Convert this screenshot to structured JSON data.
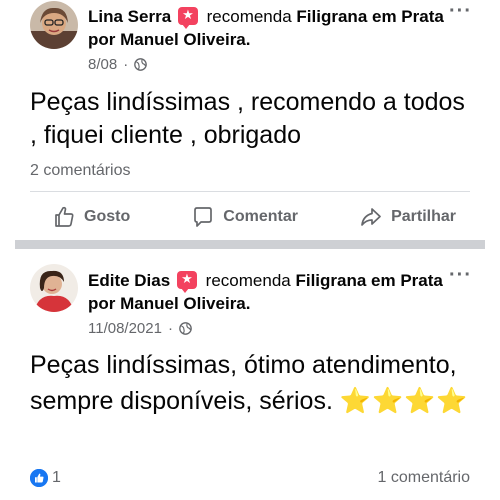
{
  "posts": [
    {
      "author": "Lina Serra",
      "verb": "recomenda",
      "page": "Filigrana em Prata por Manuel Oliveira.",
      "date": "8/08",
      "separator": "·",
      "text": "Peças lindíssimas , recomendo a todos , fiquei cliente , obrigado",
      "comments": "2 comentários",
      "actions": {
        "like": "Gosto",
        "comment": "Comentar",
        "share": "Partilhar"
      }
    },
    {
      "author": "Edite Dias",
      "verb": "recomenda",
      "page": "Filigrana em Prata por Manuel Oliveira.",
      "date": "11/08/2021",
      "separator": "·",
      "text": "Peças lindíssimas, ótimo atendimento, sempre disponíveis, sérios.",
      "stars": "⭐⭐⭐⭐",
      "reactions_count": "1",
      "comments": "1 comentário"
    }
  ],
  "icons": {
    "recommend": "recommend-star-icon",
    "globe": "globe-icon",
    "more": "more-options-icon",
    "like": "thumbs-up-icon",
    "comment": "comment-bubble-icon",
    "share": "share-arrow-icon"
  },
  "colors": {
    "recommend_badge": "#f3425f",
    "like_blue": "#1877f2",
    "secondary_text": "#65676b",
    "star": "#f7c325"
  }
}
